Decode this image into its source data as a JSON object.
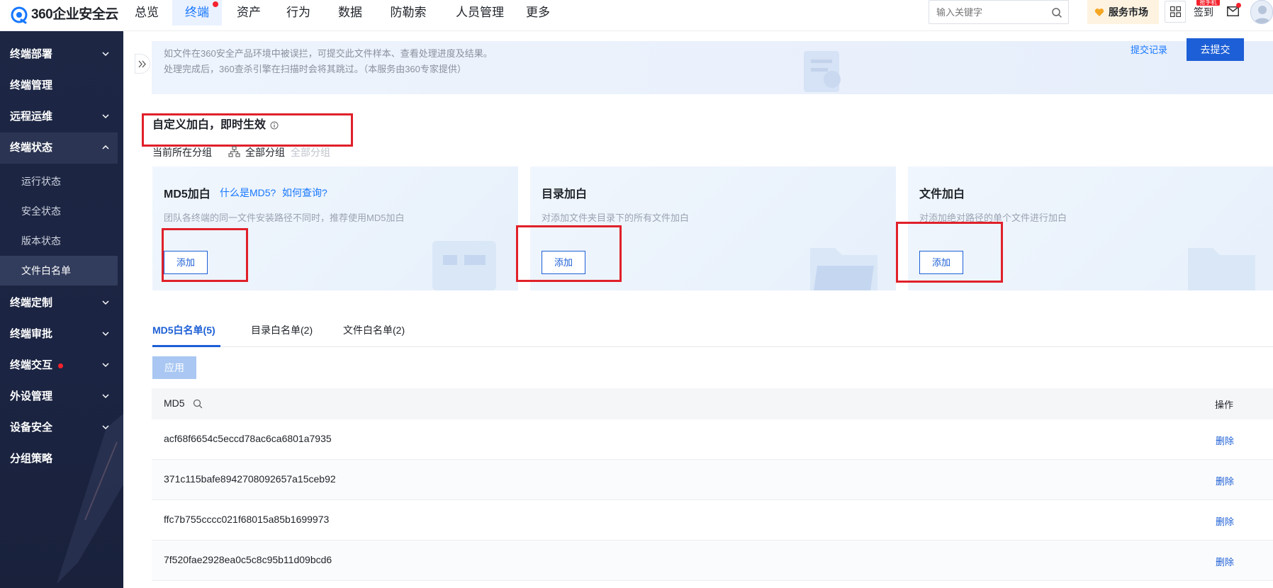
{
  "app": {
    "logo_text": "360企业安全云"
  },
  "topnav": {
    "items": [
      "总览",
      "终端",
      "资产",
      "行为",
      "数据",
      "防勒索",
      "人员管理",
      "更多"
    ],
    "active_index": 1
  },
  "search": {
    "placeholder": "输入关键字"
  },
  "header": {
    "market_label": "服务市场",
    "sign_label": "签到",
    "badge_label": "抢手机"
  },
  "sidebar": {
    "items": [
      {
        "label": "终端部署",
        "expandable": true
      },
      {
        "label": "终端管理",
        "expandable": false
      },
      {
        "label": "远程运维",
        "expandable": true
      },
      {
        "label": "终端状态",
        "expandable": true,
        "open": true
      },
      {
        "label": "终端定制",
        "expandable": true
      },
      {
        "label": "终端审批",
        "expandable": true
      },
      {
        "label": "终端交互",
        "expandable": true,
        "dot": true
      },
      {
        "label": "外设管理",
        "expandable": true
      },
      {
        "label": "设备安全",
        "expandable": true
      },
      {
        "label": "分组策略",
        "expandable": false
      }
    ],
    "sub_items": [
      "运行状态",
      "安全状态",
      "版本状态",
      "文件白名单"
    ],
    "selected_sub": "文件白名单"
  },
  "notice": {
    "line1": "如文件在360安全产品环境中被误拦，可提交此文件样本、查看处理进度及结果。",
    "line2": "处理完成后，360查杀引擎在扫描时会将其跳过。（本服务由360专家提供）",
    "record_link": "提交记录",
    "submit_button": "去提交"
  },
  "section": {
    "title": "自定义加白，即时生效",
    "group_label": "当前所在分组",
    "group_value": "全部分组",
    "group_hint": "全部分组"
  },
  "cards": [
    {
      "title": "MD5加白",
      "links": [
        "什么是MD5?",
        "如何查询?"
      ],
      "desc": "团队各终端的同一文件安装路径不同时，推荐使用MD5加白",
      "button": "添加"
    },
    {
      "title": "目录加白",
      "links": [],
      "desc": "对添加文件夹目录下的所有文件加白",
      "button": "添加"
    },
    {
      "title": "文件加白",
      "links": [],
      "desc": "对添加绝对路径的单个文件进行加白",
      "button": "添加"
    }
  ],
  "tabs": [
    {
      "label": "MD5白名单(5)",
      "active": true
    },
    {
      "label": "目录白名单(2)",
      "active": false
    },
    {
      "label": "文件白名单(2)",
      "active": false
    }
  ],
  "apply_button": "应用",
  "table": {
    "columns": [
      "MD5",
      "操作"
    ],
    "rows": [
      {
        "md5": "acf68f6654c5eccd78ac6ca6801a7935",
        "action": "删除"
      },
      {
        "md5": "371c115bafe8942708092657a15ceb92",
        "action": "删除"
      },
      {
        "md5": "ffc7b755cccc021f68015a85b1699973",
        "action": "删除"
      },
      {
        "md5": "7f520fae2928ea0c5c8c95b11d09bcd6",
        "action": "删除"
      }
    ]
  },
  "colors": {
    "primary": "#1d5fd6",
    "sidebar_bg": "#1d2744",
    "highlight_border": "#e0202a",
    "danger_dot": "#f5222d"
  }
}
